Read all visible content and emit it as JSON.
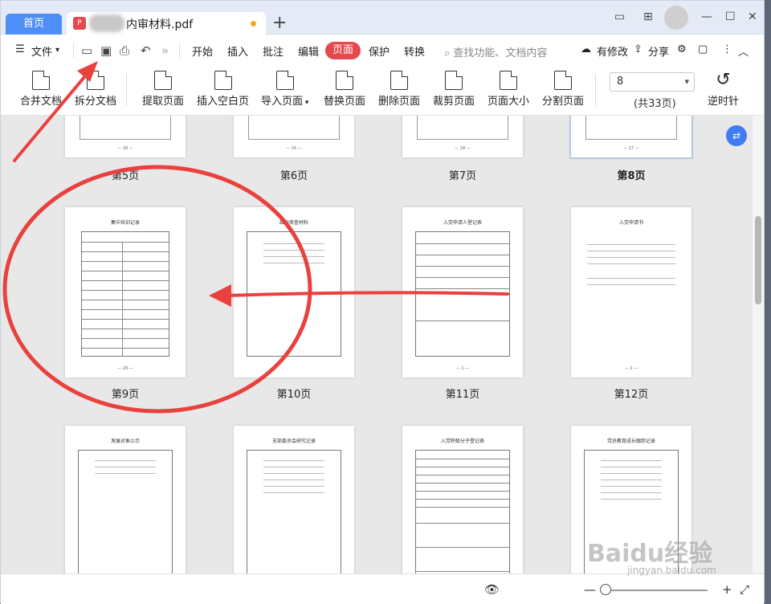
{
  "titlebar": {
    "home_tab": "首页",
    "doc_tab_title": "内审材料.pdf",
    "new_tab": "+",
    "minimize": "—",
    "restore": "☐",
    "close": "✕"
  },
  "menu": {
    "file": "文件",
    "items": [
      "开始",
      "插入",
      "批注",
      "编辑",
      "页面",
      "保护",
      "转换"
    ],
    "active": "页面",
    "search_placeholder": "查找功能、文档内容",
    "modified": "有修改",
    "share": "分享"
  },
  "ribbon": {
    "buttons": [
      "合并文档",
      "拆分文档",
      "提取页面",
      "插入空白页",
      "导入页面",
      "替换页面",
      "删除页面",
      "裁剪页面",
      "页面大小",
      "分割页面"
    ],
    "page_input": "8",
    "total_pages": "(共33页)",
    "rotate": "逆时针"
  },
  "pages": {
    "row1": [
      "第5页",
      "第6页",
      "第7页",
      "第8页"
    ],
    "row2": [
      "第9页",
      "第10页",
      "第11页",
      "第12页"
    ],
    "row2_titles": [
      "集中培训记录",
      "政治审查材料",
      "入党申请人登记表",
      "入党申请书"
    ],
    "row3_titles": [
      "发展对象公示",
      "支部委员会研究记录",
      "入党积极分子登记表",
      "党员教育成长跟踪记录"
    ],
    "page_numbers_row1": [
      "— 28 —",
      "— 26 —",
      "— 28 —",
      "— 27 —"
    ],
    "page_numbers_row2": [
      "— 28 —",
      "",
      "— 1 —",
      "— 2 —"
    ],
    "selected": "第8页"
  },
  "status": {
    "eye": "👁",
    "zoom_out": "—",
    "zoom_in": "+",
    "fit": "⤢"
  },
  "watermark": {
    "text": "Baidu经验",
    "url": "jingyan.baidu.com"
  },
  "colors": {
    "accent": "#e5484d",
    "home_tab": "#4f8ef7",
    "annotation": "#e8413e"
  }
}
